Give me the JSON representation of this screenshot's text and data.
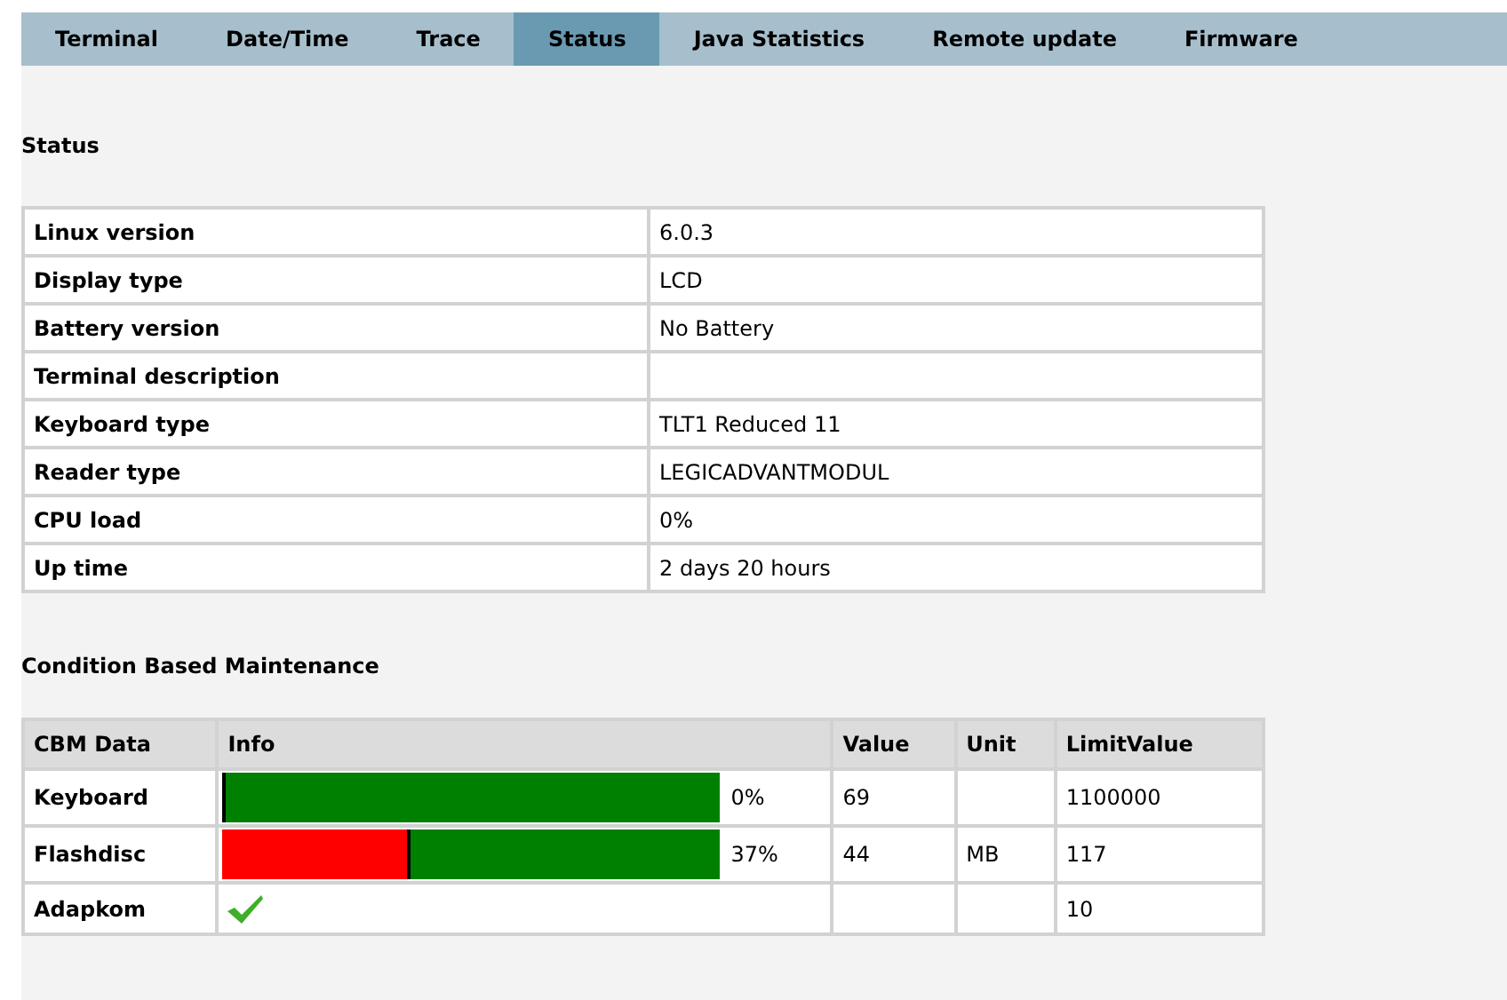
{
  "tabs": [
    {
      "label": "Terminal",
      "selected": false
    },
    {
      "label": "Date/Time",
      "selected": false
    },
    {
      "label": "Trace",
      "selected": false
    },
    {
      "label": "Status",
      "selected": true
    },
    {
      "label": "Java Statistics",
      "selected": false
    },
    {
      "label": "Remote update",
      "selected": false
    },
    {
      "label": "Firmware",
      "selected": false
    }
  ],
  "status": {
    "heading": "Status",
    "rows": [
      {
        "label": "Linux version",
        "value": "6.0.3"
      },
      {
        "label": "Display type",
        "value": "LCD"
      },
      {
        "label": "Battery version",
        "value": "No Battery"
      },
      {
        "label": "Terminal description",
        "value": ""
      },
      {
        "label": "Keyboard type",
        "value": "TLT1 Reduced 11"
      },
      {
        "label": "Reader type",
        "value": "LEGICADVANTMODUL"
      },
      {
        "label": "CPU load",
        "value": "0%"
      },
      {
        "label": "Up time",
        "value": "2 days 20 hours"
      }
    ]
  },
  "cbm": {
    "heading": "Condition Based Maintenance",
    "columns": [
      "CBM Data",
      "Info",
      "Value",
      "Unit",
      "LimitValue"
    ],
    "rows": [
      {
        "name": "Keyboard",
        "kind": "bar",
        "level": 0,
        "percent": "0%",
        "value": "69",
        "unit": "",
        "limit": "1100000"
      },
      {
        "name": "Flashdisc",
        "kind": "bar",
        "level": 0.37,
        "percent": "37%",
        "value": "44",
        "unit": "MB",
        "limit": "117"
      },
      {
        "name": "Adapkom",
        "kind": "check",
        "value": "",
        "unit": "",
        "limit": "10"
      }
    ]
  }
}
